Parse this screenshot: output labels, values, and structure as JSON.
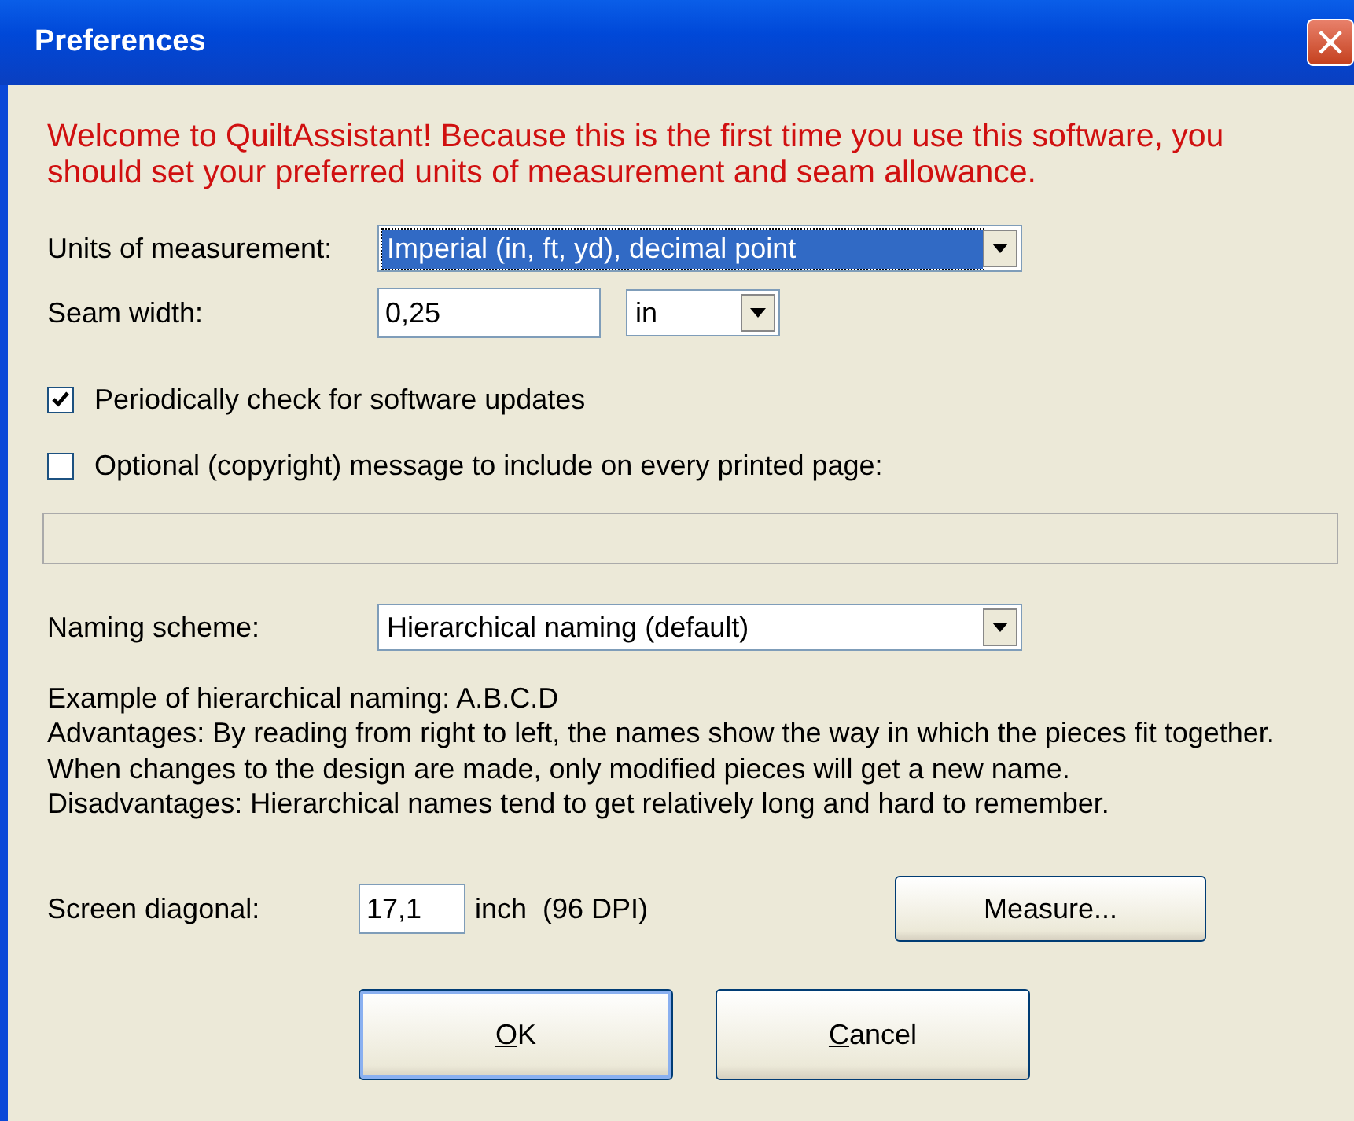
{
  "window": {
    "title": "Preferences",
    "close": "×"
  },
  "welcome": "Welcome to QuiltAssistant! Because this is the first time you use this software, you should set your preferred units of measurement and seam allowance.",
  "units": {
    "label": "Units of measurement:",
    "value": "Imperial (in, ft, yd), decimal point",
    "selected": true
  },
  "seam": {
    "label": "Seam width:",
    "value": "0,25",
    "unit": "in"
  },
  "checks": [
    {
      "label": "Periodically check for software updates",
      "checked": true
    },
    {
      "label": "Optional (copyright) message to include on every printed page:",
      "checked": false
    }
  ],
  "message_field": {
    "disabled": true
  },
  "naming": {
    "label": "Naming scheme:",
    "value": "Hierarchical naming (default)",
    "selected": false
  },
  "explanation": [
    "Example of hierarchical naming: A.B.C.D",
    "Advantages: By reading from right to left, the names show the way in which the pieces fit together. When changes to the design are made, only modified pieces will get a new name.",
    "Disadvantages: Hierarchical names tend to get relatively long and hard to remember."
  ],
  "screen": {
    "label": "Screen diagonal:",
    "value": "17,1",
    "unit": "inch  (96 DPI)",
    "button": "Measure..."
  },
  "buttons": [
    {
      "label": "OK",
      "first_letter_underlined": true,
      "default": true
    },
    {
      "label": "Cancel",
      "first_letter_underlined": true,
      "default": false
    }
  ]
}
